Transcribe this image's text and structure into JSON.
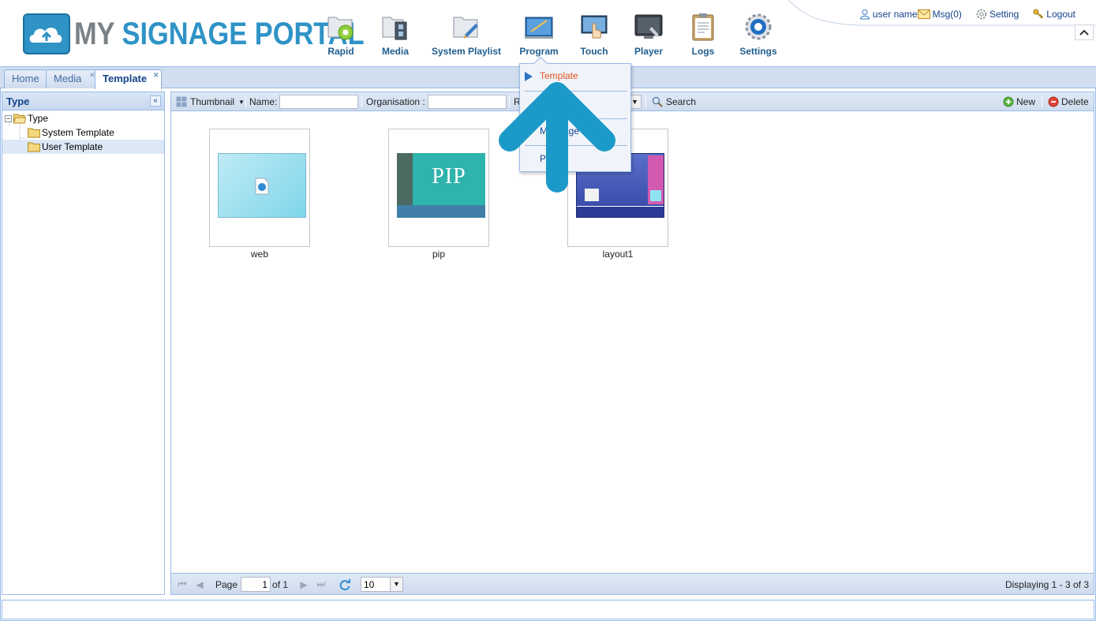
{
  "header": {
    "logo": {
      "word1": "MY",
      "word2": "SIGNAGE PORTAL"
    },
    "nav": [
      {
        "label": "Rapid",
        "icon": "rapid-folder-icon"
      },
      {
        "label": "Media",
        "icon": "media-film-icon"
      },
      {
        "label": "System Playlist",
        "icon": "playlist-folder-icon"
      },
      {
        "label": "Program",
        "icon": "program-board-icon"
      },
      {
        "label": "Touch",
        "icon": "touch-hand-icon"
      },
      {
        "label": "Player",
        "icon": "player-monitor-icon"
      },
      {
        "label": "Logs",
        "icon": "logs-clipboard-icon"
      },
      {
        "label": "Settings",
        "icon": "settings-gear-icon"
      }
    ],
    "user": {
      "name": "user name",
      "msg": "Msg(0)",
      "setting": "Setting",
      "logout": "Logout"
    }
  },
  "tabs": [
    {
      "label": "Home",
      "closable": false
    },
    {
      "label": "Media",
      "closable": true
    },
    {
      "label": "Template",
      "closable": true,
      "active": true
    }
  ],
  "sidebar": {
    "title": "Type",
    "tree": {
      "root": "Type",
      "children": [
        "System Template",
        "User Template"
      ],
      "selected": "User Template"
    }
  },
  "toolbar": {
    "view": "Thumbnail",
    "name_label": "Name:",
    "name_value": "",
    "org_label": "Organisation :",
    "org_value": "",
    "r_label": "R",
    "search": "Search",
    "new": "New",
    "delete": "Delete"
  },
  "templates": [
    {
      "name": "web",
      "kind": "web"
    },
    {
      "name": "pip",
      "kind": "pip",
      "overlay_text": "PIP"
    },
    {
      "name": "layout1",
      "kind": "layout"
    }
  ],
  "pager": {
    "page_label": "Page",
    "page_value": "1",
    "of_label": "of 1",
    "page_size": "10",
    "display": "Displaying 1 - 3 of 3"
  },
  "dropdown": {
    "items": [
      "Template",
      "",
      "Manage",
      "Publish"
    ],
    "visible_items": [
      "Template",
      "M",
      "age",
      "P",
      "h"
    ],
    "active": "Template"
  },
  "colors": {
    "accent": "#15428b",
    "brand_blue": "#2f93c6",
    "brand_gray": "#7a8288",
    "menu_active": "#e2531f",
    "arrow": "#1b9ac9"
  }
}
